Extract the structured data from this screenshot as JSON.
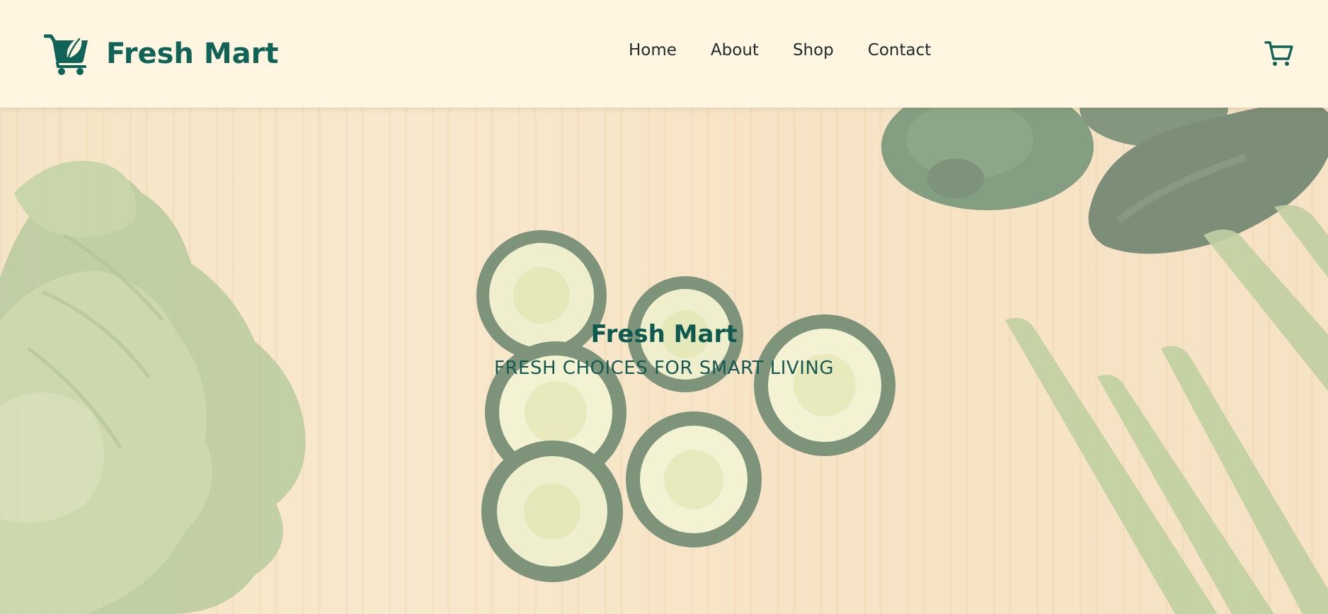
{
  "header": {
    "brand_name": "Fresh Mart",
    "logo_icon": "shopping-cart-leaf-icon",
    "nav": [
      {
        "label": "Home"
      },
      {
        "label": "About"
      },
      {
        "label": "Shop"
      },
      {
        "label": "Contact"
      }
    ],
    "cart_icon": "cart-icon"
  },
  "hero": {
    "title": "Fresh Mart",
    "subtitle": "FRESH CHOICES FOR SMART LIVING",
    "background": "vegetables-on-wooden-board"
  },
  "colors": {
    "brand": "#0f6357",
    "header_bg": "#fff5e1",
    "nav_text": "#1d2b2a",
    "hero_title": "#0e5a50"
  }
}
